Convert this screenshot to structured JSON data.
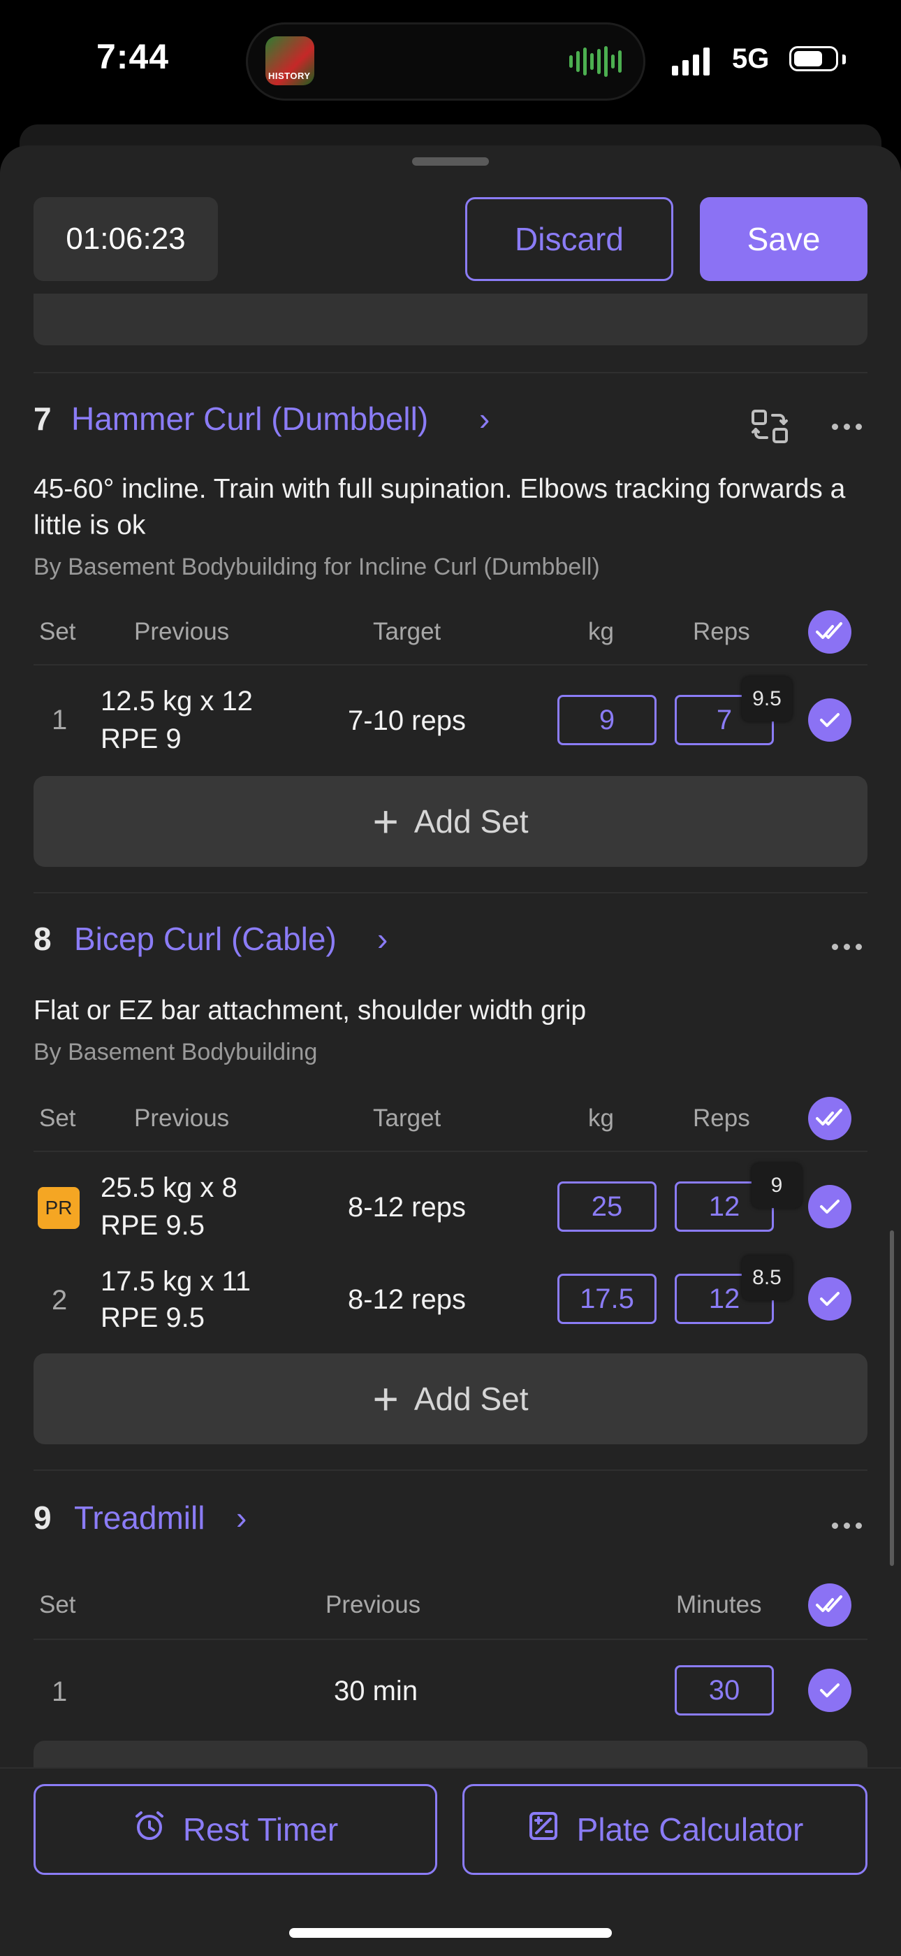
{
  "status_bar": {
    "time": "7:44",
    "network": "5G",
    "live_activity_app": "HISTORY"
  },
  "header": {
    "timer": "01:06:23",
    "discard_label": "Discard",
    "save_label": "Save"
  },
  "columns": {
    "set": "Set",
    "previous": "Previous",
    "target": "Target",
    "kg": "kg",
    "reps": "Reps",
    "minutes": "Minutes"
  },
  "exercises": [
    {
      "number": "7",
      "name": "Hammer Curl (Dumbbell)",
      "note": "45-60° incline. Train with full supination. Elbows tracking forwards a little is ok",
      "author": "By Basement Bodybuilding for Incline Curl (Dumbbell)",
      "sets": [
        {
          "set": "1",
          "prev_line1": "12.5 kg x 12",
          "prev_line2": "RPE 9",
          "target": "7-10 reps",
          "kg": "9",
          "reps": "7",
          "rpe": "9.5"
        }
      ],
      "add_set_label": "Add Set"
    },
    {
      "number": "8",
      "name": "Bicep Curl (Cable)",
      "note": "Flat or EZ bar attachment, shoulder width grip",
      "author": "By Basement Bodybuilding",
      "sets": [
        {
          "set": "PR",
          "prev_line1": "25.5 kg x 8",
          "prev_line2": "RPE 9.5",
          "target": "8-12 reps",
          "kg": "25",
          "reps": "12",
          "rpe": "9"
        },
        {
          "set": "2",
          "prev_line1": "17.5 kg x 11",
          "prev_line2": "RPE 9.5",
          "target": "8-12 reps",
          "kg": "17.5",
          "reps": "12",
          "rpe": "8.5"
        }
      ],
      "add_set_label": "Add Set"
    },
    {
      "number": "9",
      "name": "Treadmill",
      "sets": [
        {
          "set": "1",
          "previous": "30 min",
          "minutes": "30"
        }
      ]
    }
  ],
  "footer": {
    "rest_timer_label": "Rest Timer",
    "plate_calculator_label": "Plate Calculator"
  },
  "colors": {
    "accent": "#8b72f4",
    "background": "#232323",
    "pr_badge": "#f5a623"
  }
}
